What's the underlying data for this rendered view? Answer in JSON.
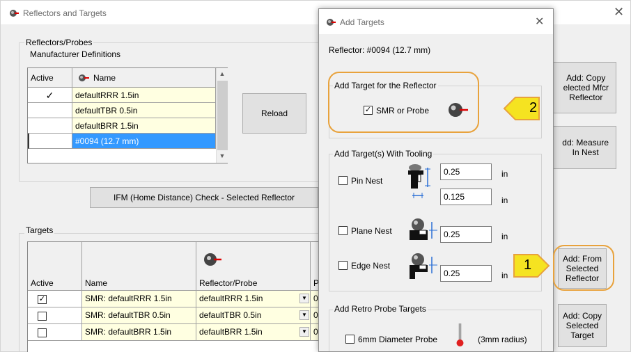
{
  "main_window": {
    "title": "Reflectors and Targets",
    "close_glyph": "✕"
  },
  "reflectors": {
    "group_label": "Reflectors/Probes",
    "mfr_label": "Manufacturer Definitions",
    "columns": [
      "Active",
      "Name"
    ],
    "rows": [
      {
        "active": "✓",
        "name": "defaultRRR 1.5in"
      },
      {
        "active": "",
        "name": "defaultTBR 0.5in"
      },
      {
        "active": "",
        "name": "defaultBRR 1.5in"
      },
      {
        "active": "",
        "name": "#0094 (12.7 mm)"
      }
    ],
    "reload_label": "Reload",
    "ifm_label": "IFM (Home Distance) Check - Selected Reflector"
  },
  "right_buttons": {
    "copy_mfcr": "Add: Copy\nelected Mfcr\nReflector",
    "measure_nest": "dd: Measure\nIn Nest",
    "from_selected": "Add: From\nSelected\nReflector",
    "copy_target": "Add: Copy\nSelected\nTarget"
  },
  "targets": {
    "group_label": "Targets",
    "columns": [
      "Active",
      "Name",
      "Reflector/Probe",
      "P"
    ],
    "rows": [
      {
        "checked": true,
        "name": "SMR: defaultRRR 1.5in",
        "reflector": "defaultRRR 1.5in",
        "p": "0."
      },
      {
        "checked": false,
        "name": "SMR: defaultTBR 0.5in",
        "reflector": "defaultTBR 0.5in",
        "p": "0."
      },
      {
        "checked": false,
        "name": "SMR: defaultBRR 1.5in",
        "reflector": "defaultBRR 1.5in",
        "p": "0."
      }
    ]
  },
  "dialog": {
    "title": "Add Targets",
    "close_glyph": "✕",
    "reflector_text": "Reflector: #0094 (12.7 mm)",
    "add_target_group": "Add Target for the Reflector",
    "smr_label": "SMR or Probe",
    "tooling_group": "Add Target(s) With Tooling",
    "pin_nest": "Pin Nest",
    "pin_value1": "0.25",
    "pin_value2": "0.125",
    "plane_nest": "Plane Nest",
    "plane_value": "0.25",
    "edge_nest": "Edge Nest",
    "edge_value": "0.25",
    "unit": "in",
    "retro_group": "Add Retro Probe Targets",
    "probe_6mm": "6mm Diameter Probe",
    "probe_radius": "(3mm radius)"
  },
  "markers": {
    "one": "1",
    "two": "2"
  },
  "colors": {
    "callout": "#e8a23c",
    "marker_fill": "#f5e321",
    "selection": "#3399ff",
    "cell_yellow": "#ffffe1"
  }
}
